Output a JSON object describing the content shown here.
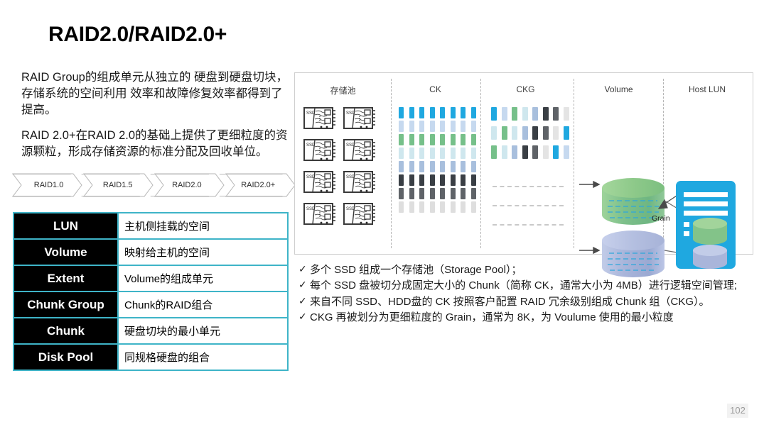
{
  "slide": {
    "title": "RAID2.0/RAID2.0+",
    "page_number": "102"
  },
  "description": {
    "paragraph1": "RAID Group的组成单元从独立的 硬盘到硬盘切块，存储系统的空间利用 效率和故障修复效率都得到了提高。",
    "paragraph2": "RAID 2.0+在RAID 2.0的基础上提供了更细粒度的资源颗粒，形成存储资源的标准分配及回收单位。"
  },
  "process_bar": {
    "steps": [
      {
        "label": "RAID1.0"
      },
      {
        "label": "RAID1.5"
      },
      {
        "label": "RAID2.0"
      },
      {
        "label": "RAID2.0+"
      }
    ]
  },
  "definition_table": {
    "rows": [
      {
        "term": "LUN",
        "desc": "主机侧挂载的空间"
      },
      {
        "term": "Volume",
        "desc": "映射给主机的空间"
      },
      {
        "term": "Extent",
        "desc": "Volume的组成单元"
      },
      {
        "term": "Chunk Group",
        "desc": "Chunk的RAID组合"
      },
      {
        "term": "Chunk",
        "desc": "硬盘切块的最小单元"
      },
      {
        "term": "Disk Pool",
        "desc": "同规格硬盘的组合"
      }
    ]
  },
  "diagram": {
    "columns": [
      {
        "label": "存储池"
      },
      {
        "label": "CK"
      },
      {
        "label": "CKG"
      },
      {
        "label": "Volume"
      },
      {
        "label": "Host LUN"
      }
    ],
    "ssd_label": "SSD",
    "grain_label": "Grain",
    "ck_rows": [
      {
        "color": "#1fa8e0"
      },
      {
        "color": "#c6d9ef"
      },
      {
        "color": "#76c08a"
      },
      {
        "color": "#cfe7ee"
      },
      {
        "color": "#a8bfdd"
      },
      {
        "color": "#3a3f45"
      },
      {
        "color": "#5f6368"
      },
      {
        "color": "#dedede"
      }
    ],
    "ckg_rows": [
      [
        "#1fa8e0",
        "#c6d9ef",
        "#76c08a",
        "#cfe7ee",
        "#a8bfdd",
        "#3a3f45",
        "#5f6368",
        "#e4e4e4"
      ],
      [
        "#cfe7ee",
        "#76c08a",
        "#cfe7ee",
        "#a8bfdd",
        "#3a3f45",
        "#5f6368",
        "#e4e4e4",
        "#1fa8e0"
      ],
      [
        "#76c08a",
        "#cfe7ee",
        "#a8bfdd",
        "#3a3f45",
        "#5f6368",
        "#e4e4e4",
        "#1fa8e0",
        "#c6d9ef"
      ]
    ],
    "volume_cylinders": [
      {
        "name": "green-volume",
        "color": "#8ec98a"
      },
      {
        "name": "blue-volume",
        "color": "#b4bfe0"
      }
    ],
    "host_lun": {
      "panel_color": "#1fa8e0",
      "stripe_color": "#ffffff"
    }
  },
  "bullets": {
    "tick": "✓",
    "items": [
      "多个 SSD 组成一个存储池（Storage Pool）；",
      "每个 SSD 盘被切分成固定大小的 Chunk（简称 CK，通常大小为 4MB）进行逻辑空间管理;",
      "来自不同 SSD、HDD盘的 CK 按照客户配置 RAID 冗余级别组成 Chunk 组（CKG）。",
      "CKG 再被划分为更细粒度的 Grain，通常为 8K，为 Voulume 使用的最小粒度"
    ]
  },
  "colors": {
    "table_border": "#3eb4c8",
    "accent_blue": "#1fa8e0",
    "accent_green": "#76c08a"
  }
}
